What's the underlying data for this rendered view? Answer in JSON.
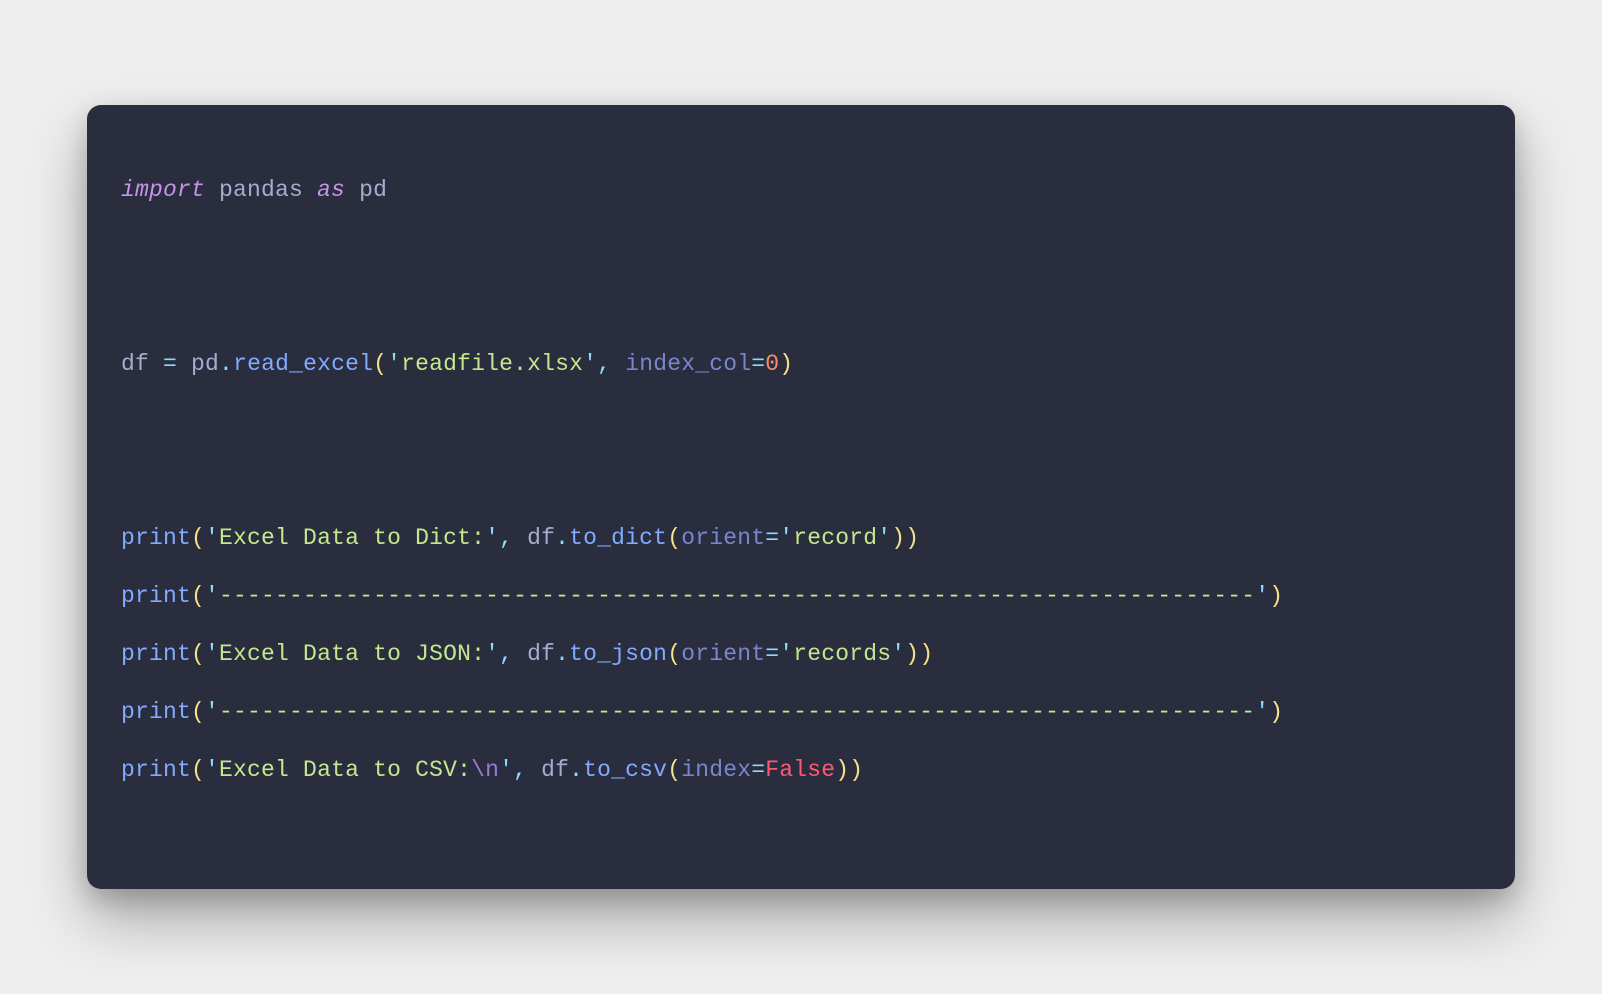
{
  "code": {
    "lines": [
      {
        "type": "code",
        "tokens": [
          {
            "cls": "tok-keyword",
            "text": "import"
          },
          {
            "cls": "tok-plain",
            "text": " pandas "
          },
          {
            "cls": "tok-keyword",
            "text": "as"
          },
          {
            "cls": "tok-plain",
            "text": " pd"
          }
        ]
      },
      {
        "type": "blank"
      },
      {
        "type": "blank"
      },
      {
        "type": "code",
        "tokens": [
          {
            "cls": "tok-plain",
            "text": "df "
          },
          {
            "cls": "tok-operator",
            "text": "="
          },
          {
            "cls": "tok-plain",
            "text": " pd"
          },
          {
            "cls": "tok-punct",
            "text": "."
          },
          {
            "cls": "tok-func",
            "text": "read_excel"
          },
          {
            "cls": "tok-paren",
            "text": "("
          },
          {
            "cls": "tok-punct",
            "text": "'"
          },
          {
            "cls": "tok-string",
            "text": "readfile.xlsx"
          },
          {
            "cls": "tok-punct",
            "text": "'"
          },
          {
            "cls": "tok-punct",
            "text": ","
          },
          {
            "cls": "tok-plain",
            "text": " "
          },
          {
            "cls": "tok-param",
            "text": "index_col"
          },
          {
            "cls": "tok-operator",
            "text": "="
          },
          {
            "cls": "tok-number",
            "text": "0"
          },
          {
            "cls": "tok-paren",
            "text": ")"
          }
        ]
      },
      {
        "type": "blank"
      },
      {
        "type": "blank"
      },
      {
        "type": "code",
        "tokens": [
          {
            "cls": "tok-func",
            "text": "print"
          },
          {
            "cls": "tok-paren",
            "text": "("
          },
          {
            "cls": "tok-punct",
            "text": "'"
          },
          {
            "cls": "tok-string",
            "text": "Excel Data to Dict:"
          },
          {
            "cls": "tok-punct",
            "text": "'"
          },
          {
            "cls": "tok-punct",
            "text": ","
          },
          {
            "cls": "tok-plain",
            "text": " df"
          },
          {
            "cls": "tok-punct",
            "text": "."
          },
          {
            "cls": "tok-func",
            "text": "to_dict"
          },
          {
            "cls": "tok-paren",
            "text": "("
          },
          {
            "cls": "tok-param",
            "text": "orient"
          },
          {
            "cls": "tok-operator",
            "text": "="
          },
          {
            "cls": "tok-punct",
            "text": "'"
          },
          {
            "cls": "tok-string",
            "text": "record"
          },
          {
            "cls": "tok-punct",
            "text": "'"
          },
          {
            "cls": "tok-paren",
            "text": ")"
          },
          {
            "cls": "tok-paren",
            "text": ")"
          }
        ]
      },
      {
        "type": "code",
        "tokens": [
          {
            "cls": "tok-func",
            "text": "print"
          },
          {
            "cls": "tok-paren",
            "text": "("
          },
          {
            "cls": "tok-punct",
            "text": "'"
          },
          {
            "cls": "tok-string",
            "text": "--------------------------------------------------------------------------"
          },
          {
            "cls": "tok-punct",
            "text": "'"
          },
          {
            "cls": "tok-paren",
            "text": ")"
          }
        ]
      },
      {
        "type": "code",
        "tokens": [
          {
            "cls": "tok-func",
            "text": "print"
          },
          {
            "cls": "tok-paren",
            "text": "("
          },
          {
            "cls": "tok-punct",
            "text": "'"
          },
          {
            "cls": "tok-string",
            "text": "Excel Data to JSON:"
          },
          {
            "cls": "tok-punct",
            "text": "'"
          },
          {
            "cls": "tok-punct",
            "text": ","
          },
          {
            "cls": "tok-plain",
            "text": " df"
          },
          {
            "cls": "tok-punct",
            "text": "."
          },
          {
            "cls": "tok-func",
            "text": "to_json"
          },
          {
            "cls": "tok-paren",
            "text": "("
          },
          {
            "cls": "tok-param",
            "text": "orient"
          },
          {
            "cls": "tok-operator",
            "text": "="
          },
          {
            "cls": "tok-punct",
            "text": "'"
          },
          {
            "cls": "tok-string",
            "text": "records"
          },
          {
            "cls": "tok-punct",
            "text": "'"
          },
          {
            "cls": "tok-paren",
            "text": ")"
          },
          {
            "cls": "tok-paren",
            "text": ")"
          }
        ]
      },
      {
        "type": "code",
        "tokens": [
          {
            "cls": "tok-func",
            "text": "print"
          },
          {
            "cls": "tok-paren",
            "text": "("
          },
          {
            "cls": "tok-punct",
            "text": "'"
          },
          {
            "cls": "tok-string",
            "text": "--------------------------------------------------------------------------"
          },
          {
            "cls": "tok-punct",
            "text": "'"
          },
          {
            "cls": "tok-paren",
            "text": ")"
          }
        ]
      },
      {
        "type": "code",
        "tokens": [
          {
            "cls": "tok-func",
            "text": "print"
          },
          {
            "cls": "tok-paren",
            "text": "("
          },
          {
            "cls": "tok-punct",
            "text": "'"
          },
          {
            "cls": "tok-string",
            "text": "Excel Data to CSV:"
          },
          {
            "cls": "tok-escape",
            "text": "\\n"
          },
          {
            "cls": "tok-punct",
            "text": "'"
          },
          {
            "cls": "tok-punct",
            "text": ","
          },
          {
            "cls": "tok-plain",
            "text": " df"
          },
          {
            "cls": "tok-punct",
            "text": "."
          },
          {
            "cls": "tok-func",
            "text": "to_csv"
          },
          {
            "cls": "tok-paren",
            "text": "("
          },
          {
            "cls": "tok-param",
            "text": "index"
          },
          {
            "cls": "tok-operator",
            "text": "="
          },
          {
            "cls": "tok-bool",
            "text": "False"
          },
          {
            "cls": "tok-paren",
            "text": ")"
          },
          {
            "cls": "tok-paren",
            "text": ")"
          }
        ]
      }
    ]
  }
}
